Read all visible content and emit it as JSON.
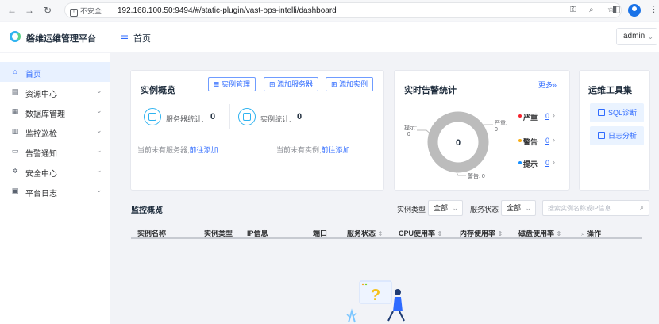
{
  "browser": {
    "secure_label": "不安全",
    "url": "192.168.100.50:9494/#/static-plugin/vast-ops-intelli/dashboard"
  },
  "header": {
    "app_title": "磐维运维管理平台",
    "page_title": "首页",
    "user": "admin"
  },
  "sidebar": {
    "items": [
      {
        "label": "首页",
        "icon": "home-icon",
        "active": true
      },
      {
        "label": "资源中心",
        "icon": "server-icon"
      },
      {
        "label": "数据库管理",
        "icon": "database-icon"
      },
      {
        "label": "监控巡检",
        "icon": "chart-icon"
      },
      {
        "label": "告警通知",
        "icon": "monitor-icon"
      },
      {
        "label": "安全中心",
        "icon": "gear-icon"
      },
      {
        "label": "平台日志",
        "icon": "log-icon"
      }
    ]
  },
  "overview": {
    "title": "实例概览",
    "buttons": [
      "实例管理",
      "添加服务器",
      "添加实例"
    ],
    "server_label": "服务器统计:",
    "server_value": "0",
    "instance_label": "实例统计:",
    "instance_value": "0",
    "server_empty": "当前未有服务器,",
    "instance_empty": "当前未有实例,",
    "go_add": "前往添加"
  },
  "alerts": {
    "title": "实时告警统计",
    "more": "更多»",
    "total": "0",
    "callouts": {
      "hint": "提示:",
      "hint_val": "0",
      "severe": "严重:",
      "severe_val": "0",
      "warning": "警告:",
      "warning_val": "0"
    },
    "legend": [
      {
        "name": "严重",
        "value": "0",
        "color": "#f5222d"
      },
      {
        "name": "警告",
        "value": "0",
        "color": "#faad14"
      },
      {
        "name": "提示",
        "value": "0",
        "color": "#1890ff"
      }
    ]
  },
  "tools": {
    "title": "运维工具集",
    "items": [
      "SQL诊断",
      "日志分析"
    ]
  },
  "monitor": {
    "title": "监控概览",
    "type_label": "实例类型",
    "type_value": "全部",
    "status_label": "服务状态",
    "status_value": "全部",
    "search_placeholder": "搜索实例名称或IP信息",
    "columns": [
      "实例名称",
      "实例类型",
      "IP信息",
      "端口",
      "服务状态",
      "CPU使用率",
      "内存使用率",
      "磁盘使用率",
      "操作"
    ]
  }
}
